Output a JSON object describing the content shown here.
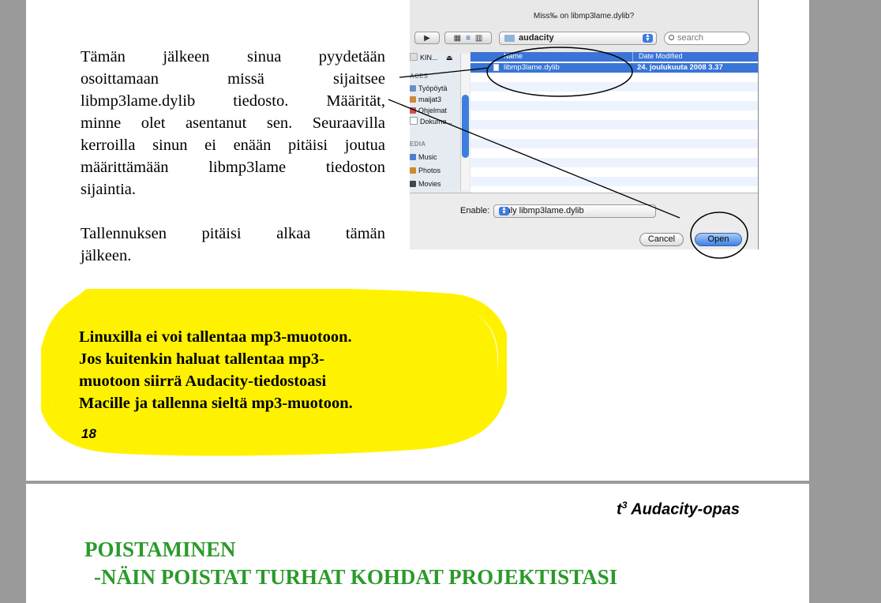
{
  "page1": {
    "paragraph1": [
      "Tämän jälkeen sinua pyydetään",
      "osoittamaan missä sijaitsee",
      "libmp3lame.dylib tiedosto. Määrität,",
      "minne olet asentanut sen. Seuraavilla",
      "kerroilla sinun ei enään pitäisi joutua",
      "määrittämään libmp3lame tiedoston",
      "sijaintia."
    ],
    "paragraph2": [
      "Tallennuksen pitäisi alkaa tämän",
      "jälkeen."
    ],
    "note": [
      "Linuxilla ei voi tallentaa mp3-muotoon.",
      "Jos kuitenkin haluat tallentaa mp3-",
      "muotoon siirrä Audacity-tiedostoasi",
      "Macille ja tallenna sieltä mp3-muotoon."
    ],
    "page_number": "18",
    "highlight_color": "#fff200"
  },
  "dialog": {
    "title": "Miss‰ on libmp3lame.dylib?",
    "folder_popup": "audacity",
    "search_placeholder": "search",
    "sidebar": {
      "device": "KIN...",
      "places_header": "ACES",
      "places": [
        "Työpöytä",
        "maijat3",
        "Ohjelmat",
        "Dokume..."
      ],
      "media_header": "EDIA",
      "media": [
        "Music",
        "Photos",
        "Movies"
      ]
    },
    "columns": {
      "name": "Name",
      "date": "Date Modified"
    },
    "selected_file": {
      "name": "libmp3lame.dylib",
      "date": "24. joulukuuta 2008 3.37"
    },
    "enable_label": "Enable:",
    "enable_value": "Only libmp3lame.dylib",
    "cancel_label": "Cancel",
    "open_label": "Open",
    "accent_color": "#3875d7"
  },
  "page2": {
    "header_t": "t",
    "header_sup": "3",
    "header_rest": " Audacity-opas",
    "title_line1": "POISTAMINEN",
    "title_line2": "-NÄIN POISTAT TURHAT KOHDAT PROJEKTISTASI",
    "title_color": "#2a9a2a"
  }
}
